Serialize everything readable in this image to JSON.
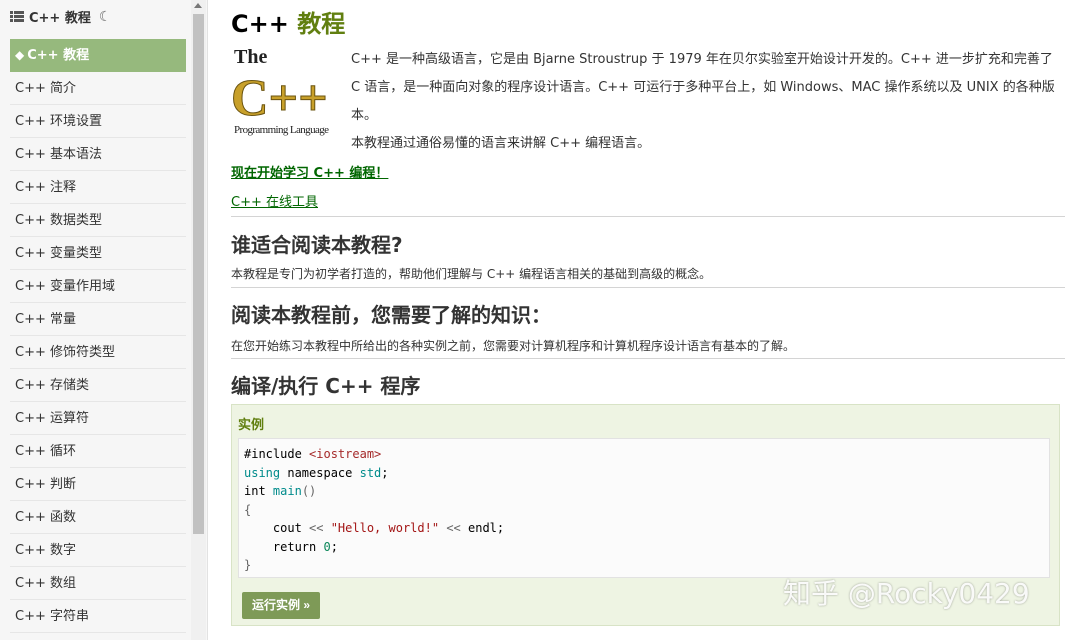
{
  "sidebar": {
    "header_title": "C++ 教程",
    "items": [
      {
        "label": "C++ 教程"
      },
      {
        "label": "C++ 简介"
      },
      {
        "label": "C++ 环境设置"
      },
      {
        "label": "C++ 基本语法"
      },
      {
        "label": "C++ 注释"
      },
      {
        "label": "C++ 数据类型"
      },
      {
        "label": "C++ 变量类型"
      },
      {
        "label": "C++ 变量作用域"
      },
      {
        "label": "C++ 常量"
      },
      {
        "label": "C++ 修饰符类型"
      },
      {
        "label": "C++ 存储类"
      },
      {
        "label": "C++ 运算符"
      },
      {
        "label": "C++ 循环"
      },
      {
        "label": "C++ 判断"
      },
      {
        "label": "C++ 函数"
      },
      {
        "label": "C++ 数字"
      },
      {
        "label": "C++ 数组"
      },
      {
        "label": "C++ 字符串"
      }
    ]
  },
  "main": {
    "title_prefix": "C++",
    "title_accent": "教程",
    "logo_text": {
      "top": "The",
      "middle": "C++",
      "bottom": "Programming Language"
    },
    "intro": [
      "C++ 是一种高级语言，它是由 Bjarne Stroustrup 于 1979 年在贝尔实验室开始设计开发的。C++ 进一步扩充和完善了 C 语言，是一种面向对象的程序设计语言。C++ 可运行于多种平台上，如 Windows、MAC 操作系统以及 UNIX 的各种版本。",
      "本教程通过通俗易懂的语言来讲解 C++ 编程语言。"
    ],
    "start_link": "现在开始学习 C++ 编程！",
    "online_link": "C++ 在线工具",
    "section1_heading": "谁适合阅读本教程?",
    "section1_text": "本教程是专门为初学者打造的，帮助他们理解与 C++ 编程语言相关的基础到高级的概念。",
    "section2_heading": "阅读本教程前，您需要了解的知识：",
    "section2_text": "在您开始练习本教程中所给出的各种实例之前，您需要对计算机程序和计算机程序设计语言有基本的了解。",
    "section3_heading": "编译/执行 C++ 程序",
    "example_title": "实例",
    "code": {
      "l1_a": "#include ",
      "l1_b": "<iostream>",
      "l2_a": "using",
      "l2_b": " namespace ",
      "l2_c": "std",
      "l2_d": ";",
      "l3_a": "int",
      "l3_b": " ",
      "l3_c": "main",
      "l3_d": "()",
      "l4": "{",
      "l5_a": "    cout ",
      "l5_b": "<<",
      "l5_c": " \"Hello, world!\" ",
      "l5_d": "<<",
      "l5_e": " endl;",
      "l6_a": "    return ",
      "l6_b": "0",
      "l6_c": ";",
      "l7": "}"
    },
    "run_button": "运行实例 »"
  },
  "watermark": "知乎 @Rocky0429",
  "colors": {
    "accent": "#617f10",
    "sidebar_active": "#96b97d",
    "example_bg": "#eef4e3",
    "run_button": "#7e9a57",
    "link": "#006600"
  }
}
